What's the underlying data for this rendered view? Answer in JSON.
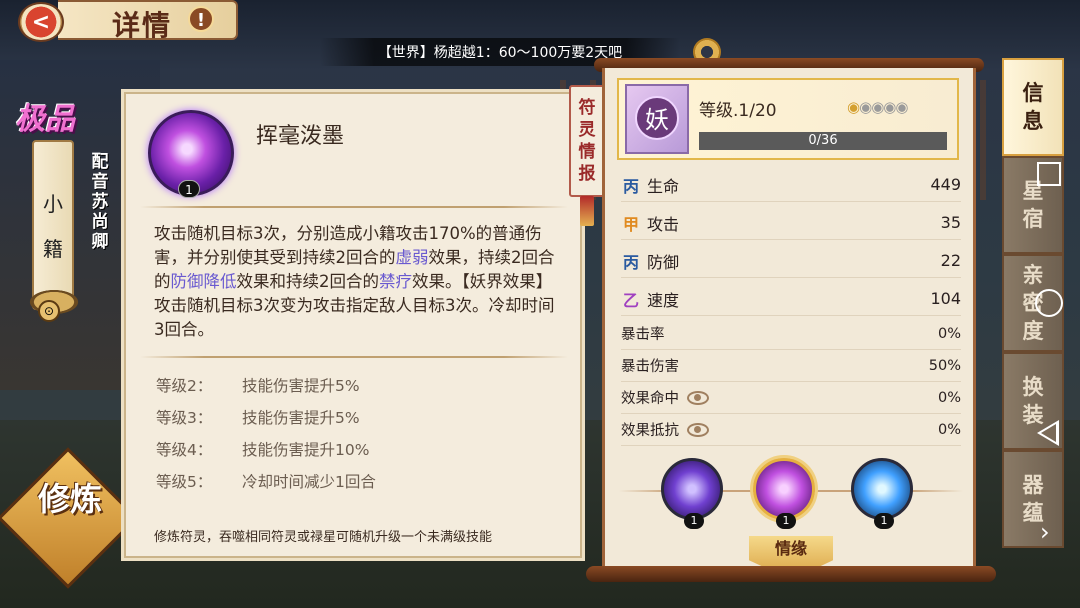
{
  "header": {
    "title": "详情",
    "info_symbol": "!",
    "back_symbol": "<"
  },
  "chat": {
    "text": "【世界】杨超越1：60～100万要2天吧"
  },
  "character": {
    "rank": "极品",
    "name_chars": [
      "小",
      "籍"
    ],
    "voice_label": "配音",
    "voice_actor": "苏尚卿"
  },
  "train_button": {
    "label": "修炼"
  },
  "skill": {
    "name": "挥毫泼墨",
    "level_badge": "1",
    "desc_parts": [
      {
        "text": "攻击随机目标3次，分别造成小籍攻击170%的普通伤害，并分别使其受到持续2回合的",
        "hl": false
      },
      {
        "text": "虚弱",
        "hl": true
      },
      {
        "text": "效果，持续2回合的",
        "hl": false
      },
      {
        "text": "防御降低",
        "hl": true
      },
      {
        "text": "效果和持续2回合的",
        "hl": false
      },
      {
        "text": "禁疗",
        "hl": true
      },
      {
        "text": "效果。【妖界效果】攻击随机目标3次变为攻击指定敌人目标3次。冷却时间3回合。",
        "hl": false
      }
    ],
    "levels": [
      {
        "level": "等级2：",
        "effect": "技能伤害提升5%"
      },
      {
        "level": "等级3：",
        "effect": "技能伤害提升5%"
      },
      {
        "level": "等级4：",
        "effect": "技能伤害提升10%"
      },
      {
        "level": "等级5：",
        "effect": "冷却时间减少1回合"
      }
    ],
    "footer": "修炼符灵，吞噬相同符灵或禄星可随机升级一个未满级技能"
  },
  "hang_tag": {
    "chars": [
      "符",
      "灵",
      "情",
      "报"
    ]
  },
  "stats": {
    "type_symbol": "妖",
    "level_text": "等级.1/20",
    "stars_on": 1,
    "stars_total": 5,
    "exp_text": "0/36",
    "exp_fraction": 0,
    "rows": [
      {
        "icon": "丙",
        "icon_color": "#2a5aa0",
        "label": "生命",
        "value": "449"
      },
      {
        "icon": "甲",
        "icon_color": "#e08a20",
        "label": "攻击",
        "value": "35"
      },
      {
        "icon": "丙",
        "icon_color": "#2a5aa0",
        "label": "防御",
        "value": "22"
      },
      {
        "icon": "乙",
        "icon_color": "#a040c0",
        "label": "速度",
        "value": "104"
      }
    ],
    "rows_small": [
      {
        "label": "暴击率",
        "value": "0%",
        "eye": false
      },
      {
        "label": "暴击伤害",
        "value": "50%",
        "eye": false
      },
      {
        "label": "效果命中",
        "value": "0%",
        "eye": true
      },
      {
        "label": "效果抵抗",
        "value": "0%",
        "eye": true
      }
    ],
    "skill_levels": [
      "1",
      "1",
      "1"
    ],
    "fate_button": "情缘"
  },
  "tabs": [
    {
      "label": [
        "信",
        "息"
      ],
      "active": true
    },
    {
      "label": [
        "星",
        "宿"
      ],
      "active": false
    },
    {
      "label": [
        "亲",
        "密",
        "度"
      ],
      "active": false
    },
    {
      "label": [
        "换",
        "装"
      ],
      "active": false
    },
    {
      "label": [
        "器",
        "蕴"
      ],
      "active": false
    }
  ]
}
